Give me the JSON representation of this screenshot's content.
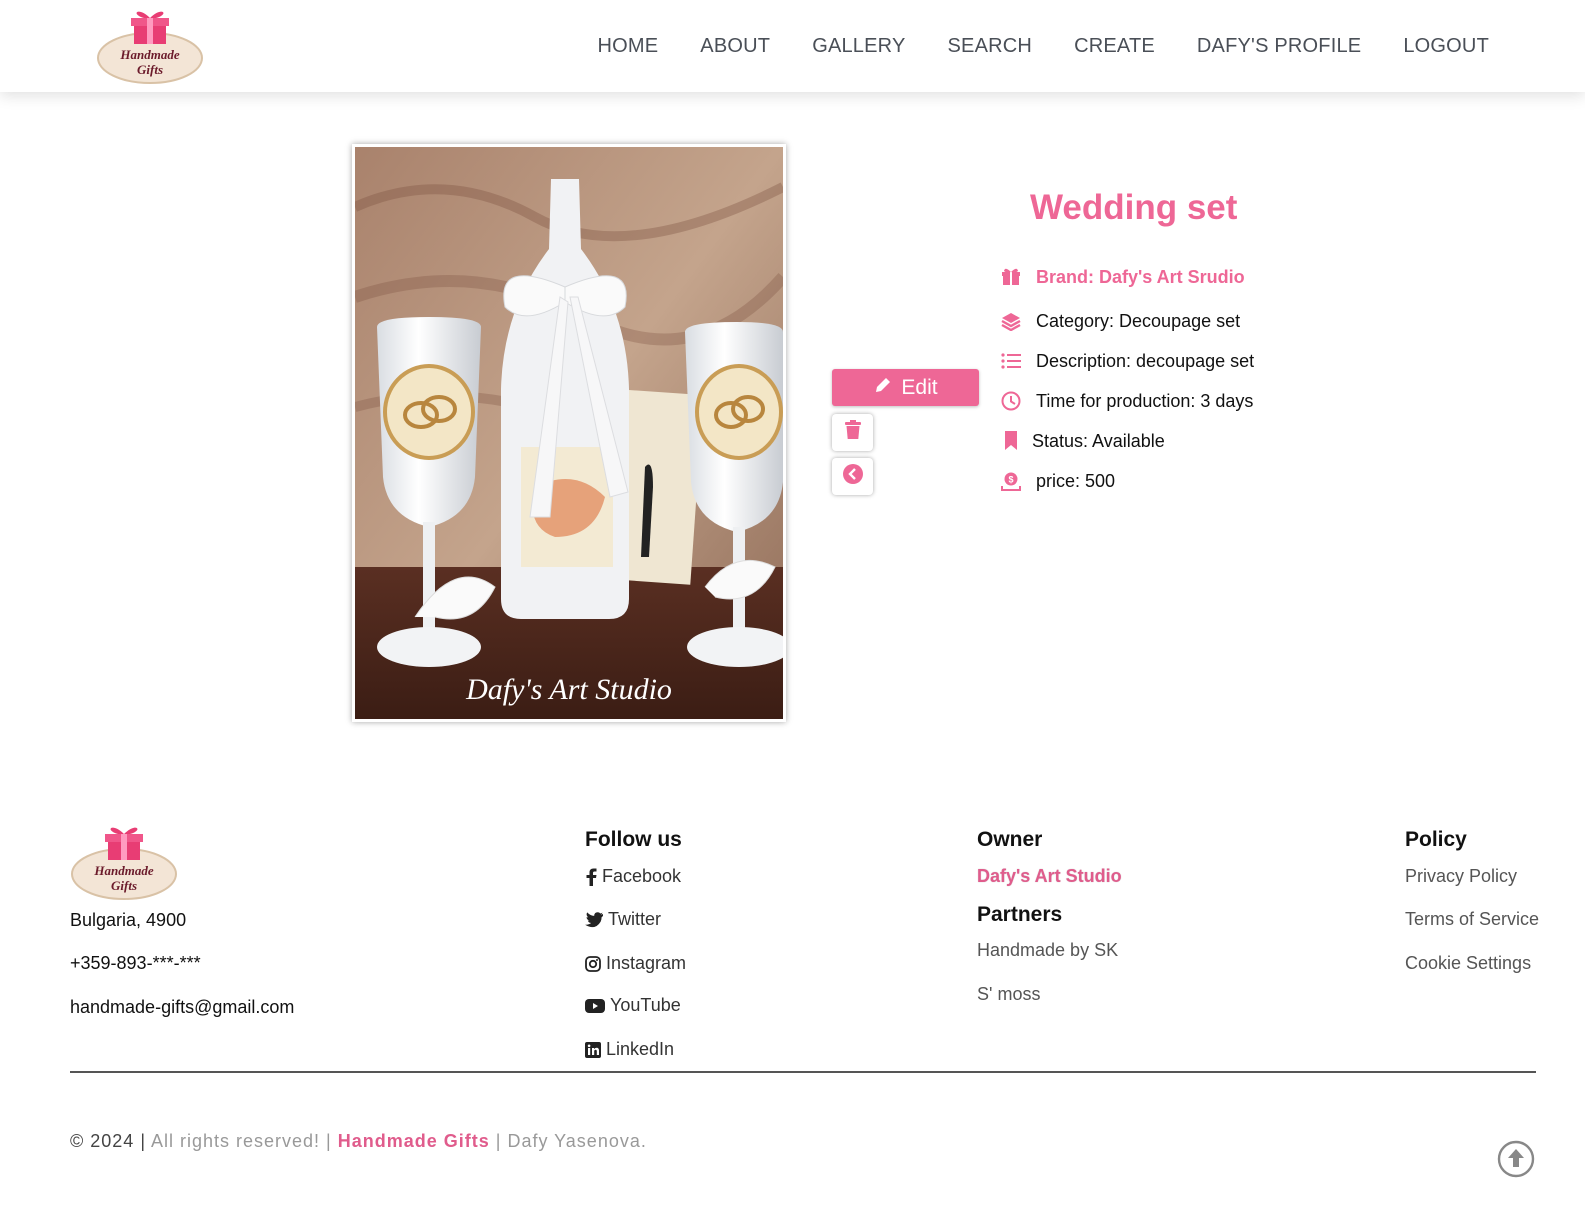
{
  "brand": {
    "logo_line1": "Handmade",
    "logo_line2": "Gifts"
  },
  "nav": {
    "home": "HOME",
    "about": "ABOUT",
    "gallery": "GALLERY",
    "search": "SEARCH",
    "create": "CREATE",
    "profile": "DAFY'S PROFILE",
    "logout": "LOGOUT"
  },
  "product": {
    "image_icon": "wedding-set-photo",
    "watermark": "Dafy's Art Studio",
    "title": "Wedding set",
    "brand": "Brand: Dafy's Art Srudio",
    "category": "Category: Decoupage set",
    "description": "Description: decoupage set",
    "time": "Time for production: 3 days",
    "status": "Status: Available",
    "price": "price: 500"
  },
  "actions": {
    "edit_label": "Edit",
    "edit_icon": "pencil-icon",
    "delete_icon": "trash-icon",
    "back_icon": "chevron-left-circle-icon"
  },
  "footer": {
    "address": "Bulgaria, 4900",
    "phone": "+359-893-***-***",
    "email": "handmade-gifts@gmail.com",
    "follow_title": "Follow us",
    "social": [
      "Facebook",
      "Twitter",
      "Instagram",
      "YouTube",
      "LinkedIn"
    ],
    "owner_title": "Owner",
    "owner_name": "Dafy's Art Studio",
    "partners_title": "Partners",
    "partners": [
      "Handmade by SK",
      "S' moss"
    ],
    "policy_title": "Policy",
    "policies": [
      "Privacy Policy",
      "Terms of Service",
      "Cookie Settings"
    ],
    "copyright_prefix": "© 2024",
    "copyright_sep1": " | ",
    "copyright_rights": "All rights reserved! | ",
    "copyright_brand": "Handmade Gifts",
    "copyright_suffix": " | Dafy Yasenova."
  },
  "colors": {
    "accent": "#ee6796",
    "nav_text": "#4a4f57"
  }
}
